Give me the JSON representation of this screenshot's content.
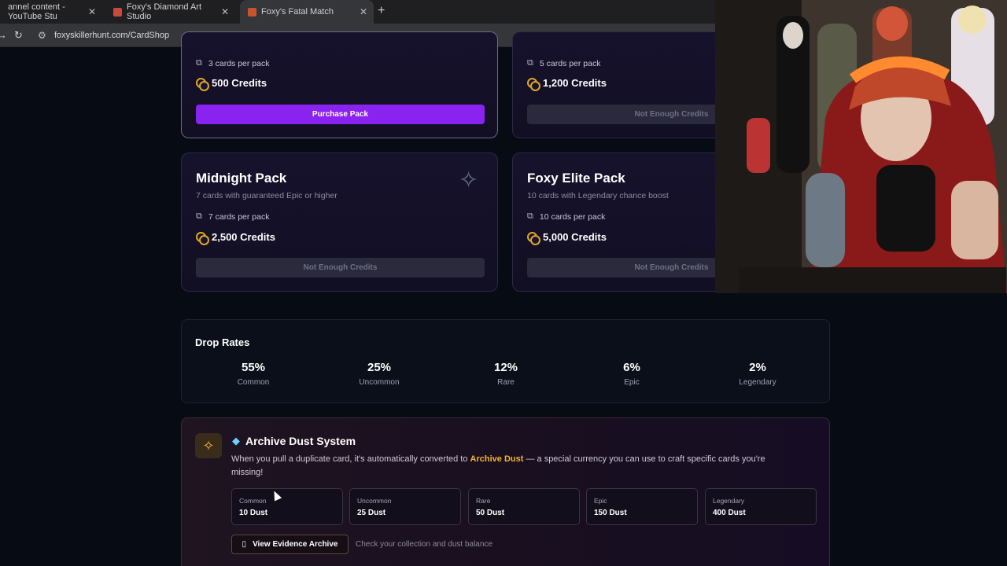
{
  "browser": {
    "tabs": [
      {
        "title": "annel content - YouTube Stu",
        "favicon_color": "#ff0000",
        "active": false
      },
      {
        "title": "Foxy's Diamond Art Studio",
        "favicon_color": "#c94a3a",
        "active": false
      },
      {
        "title": "Foxy's Fatal Match",
        "favicon_color": "#c7542a",
        "active": true
      }
    ],
    "url": "foxyskillerhunt.com/CardShop"
  },
  "packs": [
    {
      "title": "",
      "subtitle": "",
      "cards_line": "3 cards per pack",
      "price": "500 Credits",
      "button": "Purchase Pack",
      "button_state": "enabled"
    },
    {
      "title": "",
      "subtitle": "",
      "cards_line": "5 cards per pack",
      "price": "1,200 Credits",
      "button": "Not Enough Credits",
      "button_state": "disabled"
    },
    {
      "title": "Midnight Pack",
      "subtitle": "7 cards with guaranteed Epic or higher",
      "cards_line": "7 cards per pack",
      "price": "2,500 Credits",
      "button": "Not Enough Credits",
      "button_state": "disabled"
    },
    {
      "title": "Foxy Elite Pack",
      "subtitle": "10 cards with Legendary chance boost",
      "cards_line": "10 cards per pack",
      "price": "5,000 Credits",
      "button": "Not Enough Credits",
      "button_state": "disabled"
    }
  ],
  "drop_rates": {
    "title": "Drop Rates",
    "rates": [
      {
        "pct": "55%",
        "label": "Common"
      },
      {
        "pct": "25%",
        "label": "Uncommon"
      },
      {
        "pct": "12%",
        "label": "Rare"
      },
      {
        "pct": "6%",
        "label": "Epic"
      },
      {
        "pct": "2%",
        "label": "Legendary"
      }
    ]
  },
  "dust": {
    "title": "Archive Dust System",
    "desc_before": "When you pull a duplicate card, it's automatically converted to ",
    "desc_highlight": "Archive Dust",
    "desc_after": " — a special currency you can use to craft specific cards you're missing!",
    "tiers": [
      {
        "name": "Common",
        "value": "10 Dust"
      },
      {
        "name": "Uncommon",
        "value": "25 Dust"
      },
      {
        "name": "Rare",
        "value": "50 Dust"
      },
      {
        "name": "Epic",
        "value": "150 Dust"
      },
      {
        "name": "Legendary",
        "value": "400 Dust"
      }
    ],
    "button": "View Evidence Archive",
    "hint": "Check your collection and dust balance"
  },
  "icons": {
    "cards": "cards-icon",
    "coin": "coin-icon",
    "sparkle": "sparkle-icon",
    "gem": "gem-icon",
    "book": "book-icon"
  },
  "colors": {
    "accent_purple": "#8a22f0",
    "dust_gold": "#f5b32f"
  }
}
